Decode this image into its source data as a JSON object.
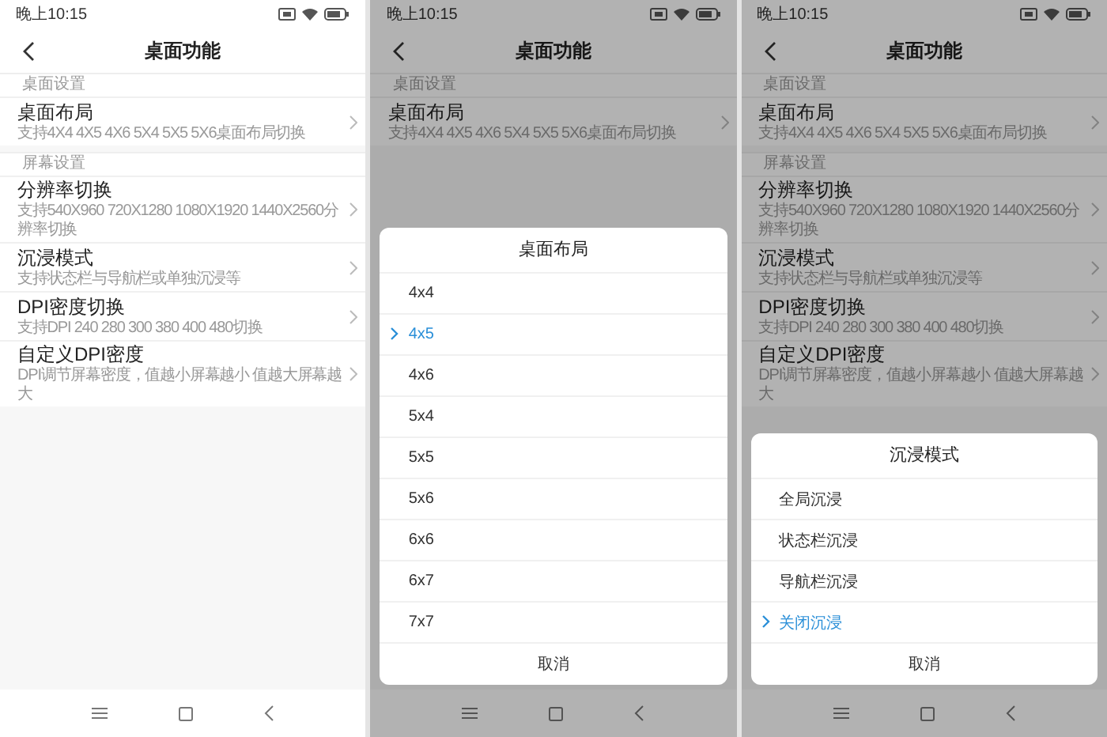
{
  "panels": [
    {
      "status_time": "晚上10:15",
      "title": "桌面功能",
      "sections": [
        {
          "label": "桌面设置",
          "items": [
            {
              "title": "桌面布局",
              "subtitle": "支持4X4 4X5 4X6 5X4 5X5 5X6桌面布局切换"
            }
          ]
        },
        {
          "label": "屏幕设置",
          "items": [
            {
              "title": "分辨率切换",
              "subtitle": "支持540X960 720X1280 1080X1920 1440X2560分辨率切换"
            },
            {
              "title": "沉浸模式",
              "subtitle": "支持状态栏与导航栏或单独沉浸等"
            },
            {
              "title": "DPI密度切换",
              "subtitle": "支持DPI 240 280 300 380 400 480切换"
            },
            {
              "title": "自定义DPI密度",
              "subtitle": "DPI调节屏幕密度，值越小屏幕越小 值越大屏幕越大"
            }
          ]
        }
      ]
    },
    {
      "status_time": "晚上10:15",
      "title": "桌面功能",
      "sections": [
        {
          "label": "桌面设置",
          "items": [
            {
              "title": "桌面布局",
              "subtitle": "支持4X4 4X5 4X6 5X4 5X5 5X6桌面布局切换"
            }
          ]
        }
      ],
      "dialog": {
        "title": "桌面布局",
        "options": [
          {
            "label": "4x4",
            "selected": false
          },
          {
            "label": "4x5",
            "selected": true
          },
          {
            "label": "4x6",
            "selected": false
          },
          {
            "label": "5x4",
            "selected": false
          },
          {
            "label": "5x5",
            "selected": false
          },
          {
            "label": "5x6",
            "selected": false
          },
          {
            "label": "6x6",
            "selected": false
          },
          {
            "label": "6x7",
            "selected": false
          },
          {
            "label": "7x7",
            "selected": false
          }
        ],
        "cancel": "取消"
      }
    },
    {
      "status_time": "晚上10:15",
      "title": "桌面功能",
      "sections": [
        {
          "label": "桌面设置",
          "items": [
            {
              "title": "桌面布局",
              "subtitle": "支持4X4 4X5 4X6 5X4 5X5 5X6桌面布局切换"
            }
          ]
        },
        {
          "label": "屏幕设置",
          "items": [
            {
              "title": "分辨率切换",
              "subtitle": "支持540X960 720X1280 1080X1920 1440X2560分辨率切换"
            },
            {
              "title": "沉浸模式",
              "subtitle": "支持状态栏与导航栏或单独沉浸等"
            },
            {
              "title": "DPI密度切换",
              "subtitle": "支持DPI 240 280 300 380 400 480切换"
            },
            {
              "title": "自定义DPI密度",
              "subtitle": "DPI调节屏幕密度，值越小屏幕越小 值越大屏幕越大"
            }
          ]
        }
      ],
      "dialog": {
        "title": "沉浸模式",
        "options": [
          {
            "label": "全局沉浸",
            "selected": false
          },
          {
            "label": "状态栏沉浸",
            "selected": false
          },
          {
            "label": "导航栏沉浸",
            "selected": false
          },
          {
            "label": "关闭沉浸",
            "selected": true
          }
        ],
        "cancel": "取消"
      }
    }
  ]
}
